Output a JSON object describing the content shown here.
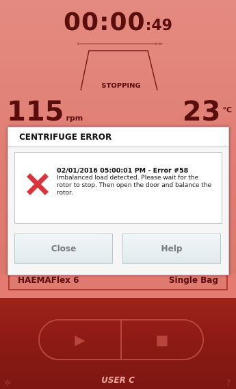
{
  "timer": {
    "main": "00:00",
    "seconds": ":49"
  },
  "status": {
    "label": "STOPPING"
  },
  "speed": {
    "value": "115",
    "unit": "rpm"
  },
  "temperature": {
    "value": "23",
    "unit": "°C"
  },
  "program": {
    "rotor": "HAEMAFlex 6",
    "mode": "Single Bag"
  },
  "dialog": {
    "title": "CENTRIFUGE ERROR",
    "error_heading": "02/01/2016 05:00:01 PM - Error #58",
    "error_message": "Imbalanced load detected. Please wait for the rotor to stop. Then open the door and balance the rotor.",
    "close_label": "Close",
    "help_label": "Help"
  },
  "controls": {
    "play_icon": "▶",
    "stop_icon": "■"
  },
  "footer": {
    "user": "USER C",
    "left_icon": "✲",
    "right_icon": "?"
  },
  "colors": {
    "top_background": "#e47a70",
    "bottom_background": "#8b1a14",
    "error_icon": "#d9343b"
  }
}
